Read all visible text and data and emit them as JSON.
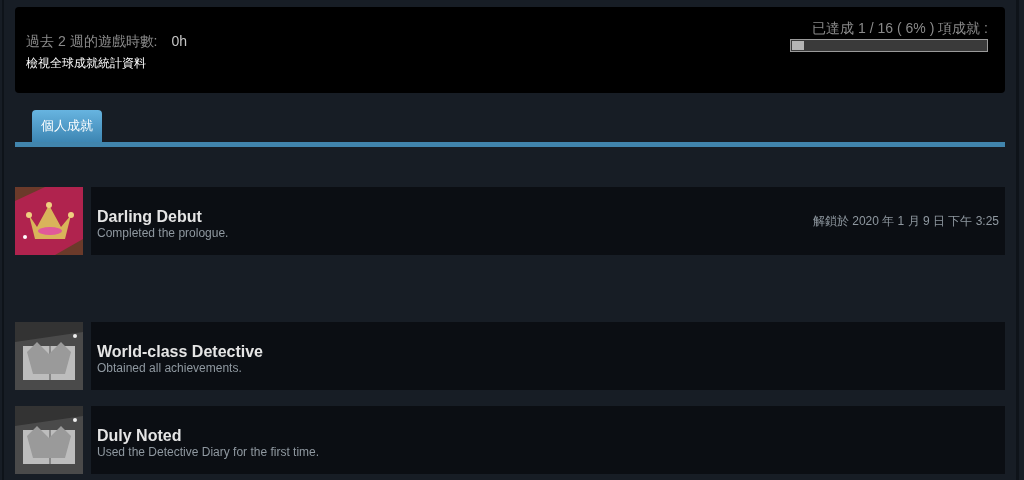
{
  "summary": {
    "playtime_label": "過去 2 週的遊戲時數:",
    "playtime_value": "0h",
    "global_stats_link": "檢視全球成就統計資料",
    "progress_label": "已達成 1 / 16 ( 6% ) 項成就 :",
    "level": 0.06
  },
  "tabs": [
    {
      "label": "個人成就",
      "selected": true
    }
  ],
  "achievements": [
    {
      "title": "Darling Debut",
      "description": "Completed the prologue.",
      "unlocked": true,
      "unlock_time": "解鎖於 2020 年 1 月 9 日 下午 3:25"
    },
    {
      "title": "World-class Detective",
      "description": "Obtained all achievements.",
      "unlocked": false
    },
    {
      "title": "Duly Noted",
      "description": "Used the Detective Diary for the first time.",
      "unlocked": false
    }
  ]
}
